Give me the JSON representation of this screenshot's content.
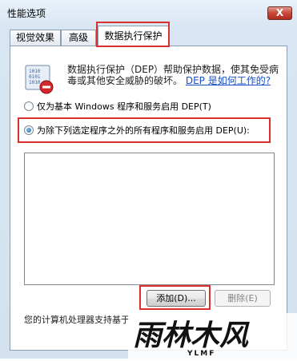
{
  "window": {
    "title": "性能选项",
    "close_glyph": "X"
  },
  "tabs": [
    {
      "label": "视觉效果",
      "active": false
    },
    {
      "label": "高级",
      "active": false
    },
    {
      "label": "数据执行保护",
      "active": true
    }
  ],
  "dep": {
    "description": "数据执行保护（DEP）帮助保护数据，使其免受病毒或其他安全威胁的破坏。",
    "link": "DEP 是如何工作的?",
    "option_essential": "仅为基本 Windows 程序和服务启用 DEP(T)",
    "option_all": "为除下列选定程序之外的所有程序和服务启用 DEP(U):",
    "selected_option": "option_all",
    "add_button": "添加(D)...",
    "remove_button": "删除(E)",
    "footer": "您的计算机处理器支持基于"
  },
  "watermark": {
    "brand_cn": "雨林木风",
    "brand_en": "YLMF"
  },
  "colors": {
    "highlight_box": "#dc3030",
    "link": "#1a4fbf"
  }
}
